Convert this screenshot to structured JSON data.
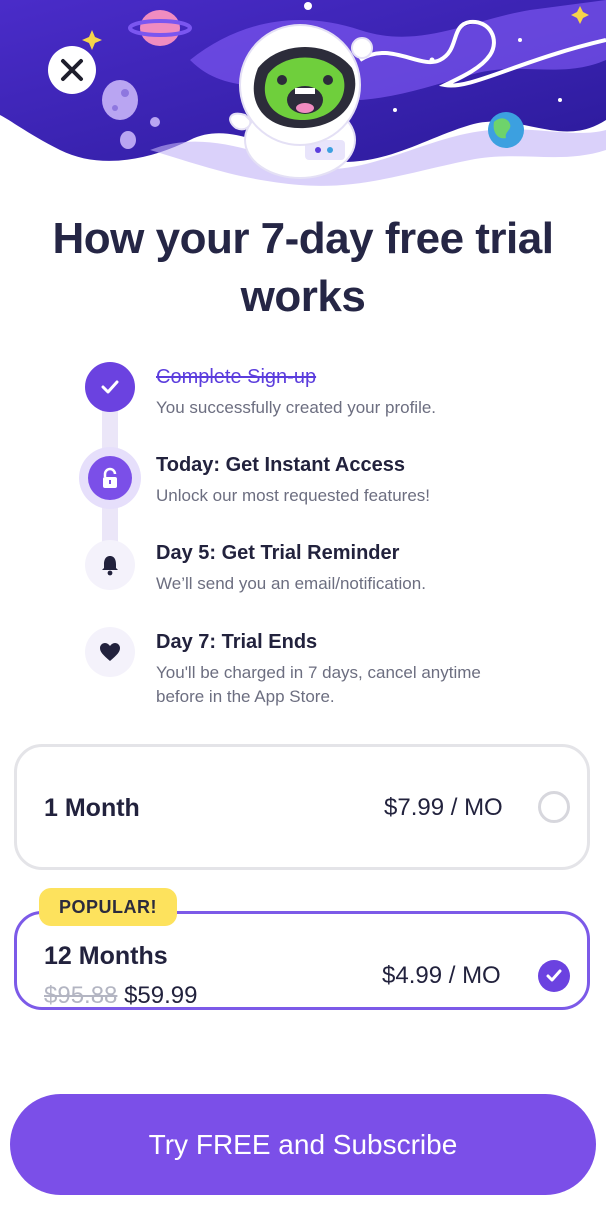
{
  "header": {
    "close_icon": "close-icon",
    "illustration": "astronaut-space-illustration"
  },
  "title": "How your 7-day free trial works",
  "steps": [
    {
      "icon": "check-icon",
      "title": "Complete Sign-up",
      "description": "You successfully created your profile.",
      "completed": true
    },
    {
      "icon": "lock-icon",
      "title": "Today: Get Instant Access",
      "description": "Unlock our most requested features!",
      "completed": false
    },
    {
      "icon": "bell-icon",
      "title": "Day 5: Get Trial Reminder",
      "description": "We’ll send you an email/notification.",
      "completed": false
    },
    {
      "icon": "heart-icon",
      "title": "Day 7: Trial Ends",
      "description": "You'll be charged in 7 days, cancel anytime before in the App Store.",
      "completed": false
    }
  ],
  "plans": [
    {
      "name": "1 Month",
      "price": "$7.99 / MO",
      "selected": false
    },
    {
      "name": "12 Months",
      "badge": "POPULAR!",
      "old_price": "$95.88",
      "new_price": "$59.99",
      "price": "$4.99 / MO",
      "selected": true
    }
  ],
  "cta": {
    "label": "Try FREE and Subscribe"
  },
  "colors": {
    "primary": "#7b4fe8",
    "accent": "#6b42e0",
    "badge": "#fde25d",
    "text": "#252645",
    "muted": "#6c6e80"
  }
}
